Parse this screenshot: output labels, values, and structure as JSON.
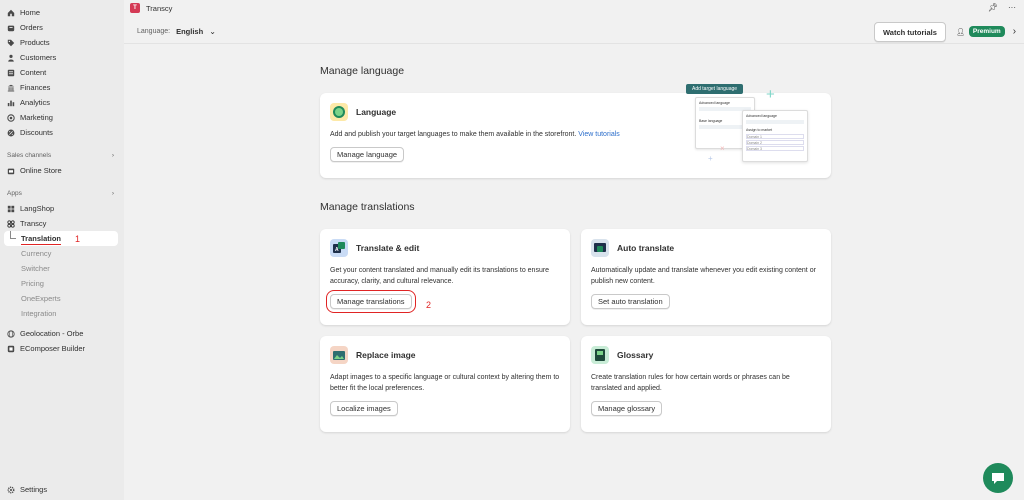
{
  "sidebar": {
    "main_items": [
      {
        "label": "Home",
        "icon": "home-icon"
      },
      {
        "label": "Orders",
        "icon": "orders-icon"
      },
      {
        "label": "Products",
        "icon": "tag-icon"
      },
      {
        "label": "Customers",
        "icon": "person-icon"
      },
      {
        "label": "Content",
        "icon": "content-icon"
      },
      {
        "label": "Finances",
        "icon": "bank-icon"
      },
      {
        "label": "Analytics",
        "icon": "chart-icon"
      },
      {
        "label": "Marketing",
        "icon": "target-icon"
      },
      {
        "label": "Discounts",
        "icon": "discount-icon"
      }
    ],
    "sales_channels_label": "Sales channels",
    "online_store": "Online Store",
    "apps_label": "Apps",
    "langshop": "LangShop",
    "transcy": "Transcy",
    "sub_items": [
      "Translation",
      "Currency",
      "Switcher",
      "Pricing",
      "OneExperts",
      "Integration"
    ],
    "geolocation": "Geolocation - Orbe",
    "ecomposer": "EComposer Builder",
    "settings": "Settings"
  },
  "annotations": {
    "one": "1",
    "two": "2"
  },
  "topbar": {
    "app_title": "Transcy"
  },
  "subbar": {
    "language_label": "Language:",
    "language_value": "English",
    "watch_tutorials": "Watch tutorials",
    "premium": "Premium"
  },
  "manage_language": {
    "heading": "Manage language",
    "card_title": "Language",
    "desc": "Add and publish your target languages to make them available in the storefront.",
    "link": "View tutorials",
    "button": "Manage language",
    "illustration": {
      "add_target": "Add target language",
      "advanced_language": "Advanced language",
      "base_language": "Base language",
      "advanced_language_2": "Advanced language",
      "assign_market": "Assign to market",
      "domain_1": "Domain 1",
      "domain_2": "Domain 2",
      "domain_3": "Domain 3"
    }
  },
  "manage_translations": {
    "heading": "Manage translations",
    "cards": [
      {
        "title": "Translate & edit",
        "desc": "Get your content translated and manually edit its translations to ensure accuracy, clarity, and cultural relevance.",
        "button": "Manage translations"
      },
      {
        "title": "Auto translate",
        "desc": "Automatically update and translate whenever you edit existing content or publish new content.",
        "button": "Set auto translation"
      },
      {
        "title": "Replace image",
        "desc": "Adapt images to a specific language or cultural context by altering them to better fit the local preferences.",
        "button": "Localize images"
      },
      {
        "title": "Glossary",
        "desc": "Create translation rules for how certain words or phrases can be translated and applied.",
        "button": "Manage glossary"
      }
    ]
  },
  "colors": {
    "accent_green": "#1f8a5b",
    "annotation_red": "#e02424",
    "link_blue": "#2c6ecb"
  }
}
